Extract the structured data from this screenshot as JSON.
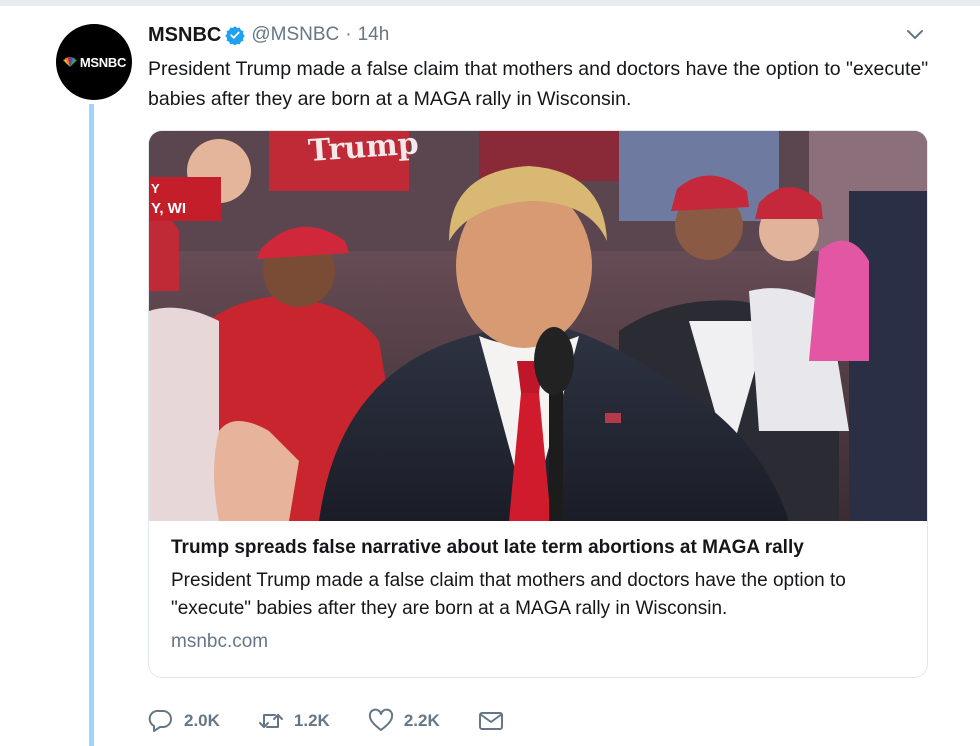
{
  "tweet": {
    "avatar_text": "MSNBC",
    "name": "MSNBC",
    "handle": "@MSNBC",
    "separator": "·",
    "time": "14h",
    "text": "President Trump made a false claim that mothers and doctors have the option to \"execute\" babies after they are born at a MAGA rally in Wisconsin."
  },
  "card": {
    "image": {
      "overlay_line1": "Y",
      "overlay_line2": "Y, WI",
      "sign_text": "Trump"
    },
    "title": "Trump spreads false narrative about late term abortions at MAGA rally",
    "description": "President Trump made a false claim that mothers and doctors have the option to \"execute\" babies after they are born at a MAGA rally in Wisconsin.",
    "domain": "msnbc.com"
  },
  "actions": {
    "reply_count": "2.0K",
    "retweet_count": "1.2K",
    "like_count": "2.2K"
  },
  "icons": [
    "verified-icon",
    "chevron-down-icon",
    "reply-icon",
    "retweet-icon",
    "like-icon",
    "direct-message-icon"
  ],
  "colors": {
    "verified": "#1da1f2",
    "thread_line": "#9fd3f7",
    "muted_text": "#657786"
  }
}
